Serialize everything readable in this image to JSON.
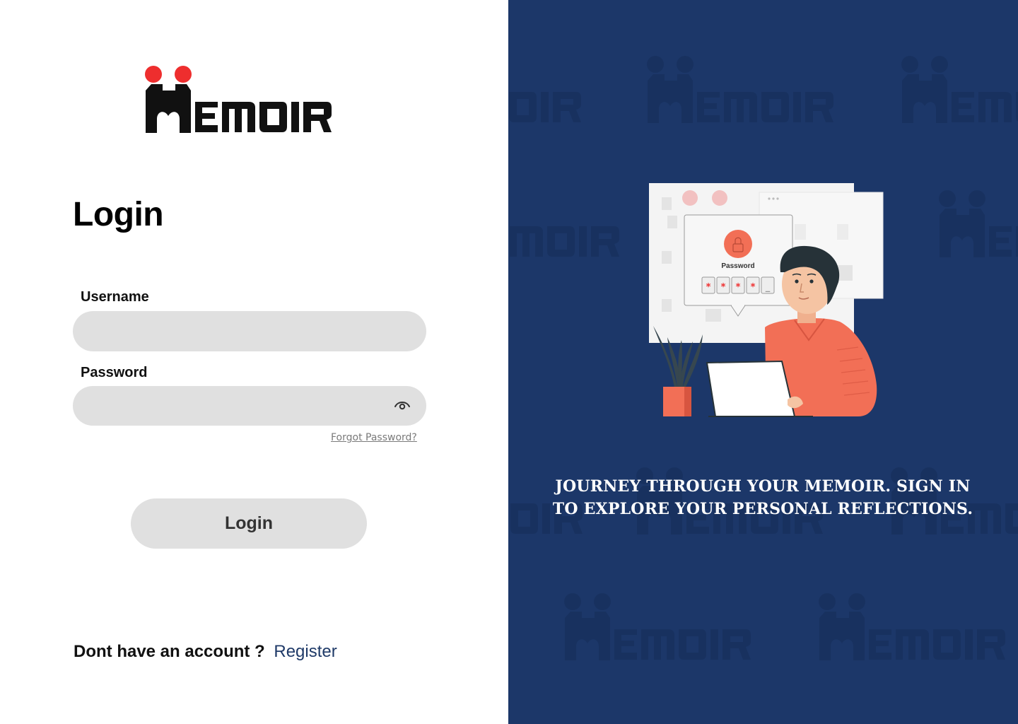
{
  "brand": {
    "logo_text": "MEMOIR",
    "logo_dot_color": "#ee2e2e",
    "logo_ink_color": "#111111"
  },
  "login_form": {
    "title": "Login",
    "username_label": "Username",
    "username_value": "",
    "password_label": "Password",
    "password_value": "",
    "show_password_icon": "eye-icon",
    "forgot_password_link": "Forgot Password?",
    "submit_label": "Login"
  },
  "register": {
    "prompt": "Dont have an account ?",
    "link_label": "Register"
  },
  "hero": {
    "background_color": "#1c3769",
    "illustration_password_label": "Password",
    "illustration_mask_chars": [
      "*",
      "*",
      "*",
      "*",
      "_"
    ],
    "tagline": "JOURNEY THROUGH YOUR MEMOIR. SIGN IN TO EXPLORE YOUR PERSONAL REFLECTIONS."
  },
  "colors": {
    "accent_red": "#ee2e2e",
    "navy": "#1c3769",
    "link_blue": "#1f3a68",
    "input_gray": "#e0e0e0",
    "person_shirt": "#f26f56"
  }
}
